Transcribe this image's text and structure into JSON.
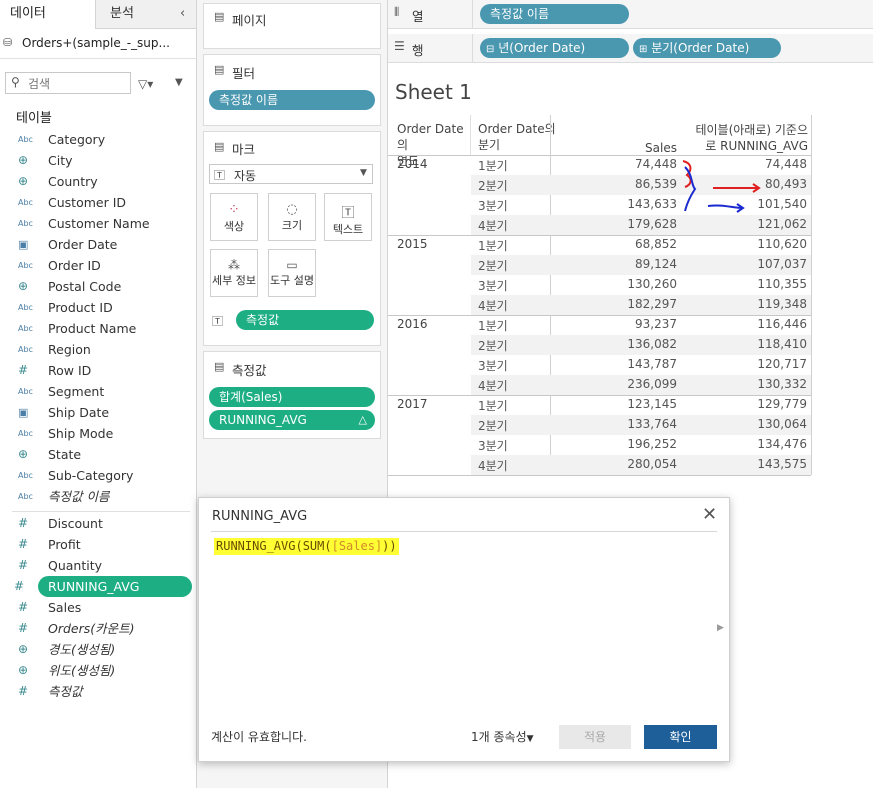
{
  "tabs": {
    "data": "데이터",
    "analysis": "분석"
  },
  "datasource": "Orders+(sample_-_sup...",
  "search": {
    "placeholder": "검색"
  },
  "tables_title": "테이블",
  "dimensions": [
    {
      "type": "Abc",
      "icon": "abc-icon",
      "label": "Category"
    },
    {
      "type": "globe",
      "icon": "globe-icon",
      "label": "City"
    },
    {
      "type": "globe",
      "icon": "globe-icon",
      "label": "Country"
    },
    {
      "type": "Abc",
      "icon": "abc-icon",
      "label": "Customer ID"
    },
    {
      "type": "Abc",
      "icon": "abc-icon",
      "label": "Customer Name"
    },
    {
      "type": "cal",
      "icon": "calendar-icon",
      "label": "Order Date"
    },
    {
      "type": "Abc",
      "icon": "abc-icon",
      "label": "Order ID"
    },
    {
      "type": "globe",
      "icon": "globe-icon",
      "label": "Postal Code"
    },
    {
      "type": "Abc",
      "icon": "abc-icon",
      "label": "Product ID"
    },
    {
      "type": "Abc",
      "icon": "abc-icon",
      "label": "Product Name"
    },
    {
      "type": "Abc",
      "icon": "abc-icon",
      "label": "Region"
    },
    {
      "type": "hash",
      "icon": "hash-icon",
      "label": "Row ID"
    },
    {
      "type": "Abc",
      "icon": "abc-icon",
      "label": "Segment"
    },
    {
      "type": "cal",
      "icon": "calendar-icon",
      "label": "Ship Date"
    },
    {
      "type": "Abc",
      "icon": "abc-icon",
      "label": "Ship Mode"
    },
    {
      "type": "globe",
      "icon": "globe-icon",
      "label": "State"
    },
    {
      "type": "Abc",
      "icon": "abc-icon",
      "label": "Sub-Category"
    },
    {
      "type": "Abc",
      "icon": "abc-icon",
      "label": "측정값 이름",
      "italic": true
    }
  ],
  "measures": [
    {
      "type": "hash",
      "icon": "hash-icon",
      "label": "Discount"
    },
    {
      "type": "hash",
      "icon": "hash-icon",
      "label": "Profit"
    },
    {
      "type": "hash",
      "icon": "hash-icon",
      "label": "Quantity"
    },
    {
      "type": "hash",
      "icon": "calc-hash-icon",
      "label": "RUNNING_AVG",
      "selected": true
    },
    {
      "type": "hash",
      "icon": "hash-icon",
      "label": "Sales"
    },
    {
      "type": "hash",
      "icon": "hash-icon",
      "label": "Orders(카운트)",
      "italic": true
    },
    {
      "type": "globe",
      "icon": "globe-icon",
      "label": "경도(생성됨)",
      "italic": true
    },
    {
      "type": "globe",
      "icon": "globe-icon",
      "label": "위도(생성됨)",
      "italic": true
    },
    {
      "type": "hash",
      "icon": "hash-icon",
      "label": "측정값",
      "italic": true
    }
  ],
  "shelves": {
    "pages": "페이지",
    "filters": "필터",
    "filter_pill": "측정값 이름",
    "marks": "마크",
    "mark_type": "자동",
    "mark_buttons": {
      "color": "색상",
      "size": "크기",
      "text": "텍스트",
      "detail": "세부 정보",
      "tooltip": "도구 설명"
    },
    "text_pill": "측정값",
    "measure_values": "측정값",
    "measure_pills": [
      "합계(Sales)",
      "RUNNING_AVG"
    ]
  },
  "columns_shelf": {
    "label": "열",
    "pill": "측정값 이름"
  },
  "rows_shelf": {
    "label": "행",
    "pills": [
      "년(Order Date)",
      "분기(Order Date)"
    ]
  },
  "sheet_title": "Sheet 1",
  "table": {
    "headers": {
      "year_line1": "Order Date의",
      "year_line2": "연도",
      "quarter_line1": "Order Date의",
      "quarter_line2": "분기",
      "sales": "Sales",
      "ravg_line1": "테이블(아래로) 기준으",
      "ravg_line2": "로 RUNNING_AVG"
    },
    "rows": [
      {
        "year": "2014",
        "q": "1분기",
        "sales": "74,448",
        "ravg": "74,448"
      },
      {
        "year": "",
        "q": "2분기",
        "sales": "86,539",
        "ravg": "80,493"
      },
      {
        "year": "",
        "q": "3분기",
        "sales": "143,633",
        "ravg": "101,540"
      },
      {
        "year": "",
        "q": "4분기",
        "sales": "179,628",
        "ravg": "121,062"
      },
      {
        "year": "2015",
        "q": "1분기",
        "sales": "68,852",
        "ravg": "110,620"
      },
      {
        "year": "",
        "q": "2분기",
        "sales": "89,124",
        "ravg": "107,037"
      },
      {
        "year": "",
        "q": "3분기",
        "sales": "130,260",
        "ravg": "110,355"
      },
      {
        "year": "",
        "q": "4분기",
        "sales": "182,297",
        "ravg": "119,348"
      },
      {
        "year": "2016",
        "q": "1분기",
        "sales": "93,237",
        "ravg": "116,446"
      },
      {
        "year": "",
        "q": "2분기",
        "sales": "136,082",
        "ravg": "118,410"
      },
      {
        "year": "",
        "q": "3분기",
        "sales": "143,787",
        "ravg": "120,717"
      },
      {
        "year": "",
        "q": "4분기",
        "sales": "236,099",
        "ravg": "130,332"
      },
      {
        "year": "2017",
        "q": "1분기",
        "sales": "123,145",
        "ravg": "129,779"
      },
      {
        "year": "",
        "q": "2분기",
        "sales": "133,764",
        "ravg": "130,064"
      },
      {
        "year": "",
        "q": "3분기",
        "sales": "196,252",
        "ravg": "134,476"
      },
      {
        "year": "",
        "q": "4분기",
        "sales": "280,054",
        "ravg": "143,575"
      }
    ]
  },
  "dialog": {
    "title": "RUNNING_AVG",
    "formula_fn": "RUNNING_AVG(SUM(",
    "formula_field": "[Sales]",
    "formula_end": "))",
    "status": "계산이 유효합니다.",
    "dependencies": "1개 종속성",
    "apply": "적용",
    "ok": "확인"
  },
  "colors": {
    "blue_pill": "#4a97b0",
    "green_pill": "#1eae84",
    "ok_button": "#1f5f99",
    "highlight": "#ffff33"
  }
}
